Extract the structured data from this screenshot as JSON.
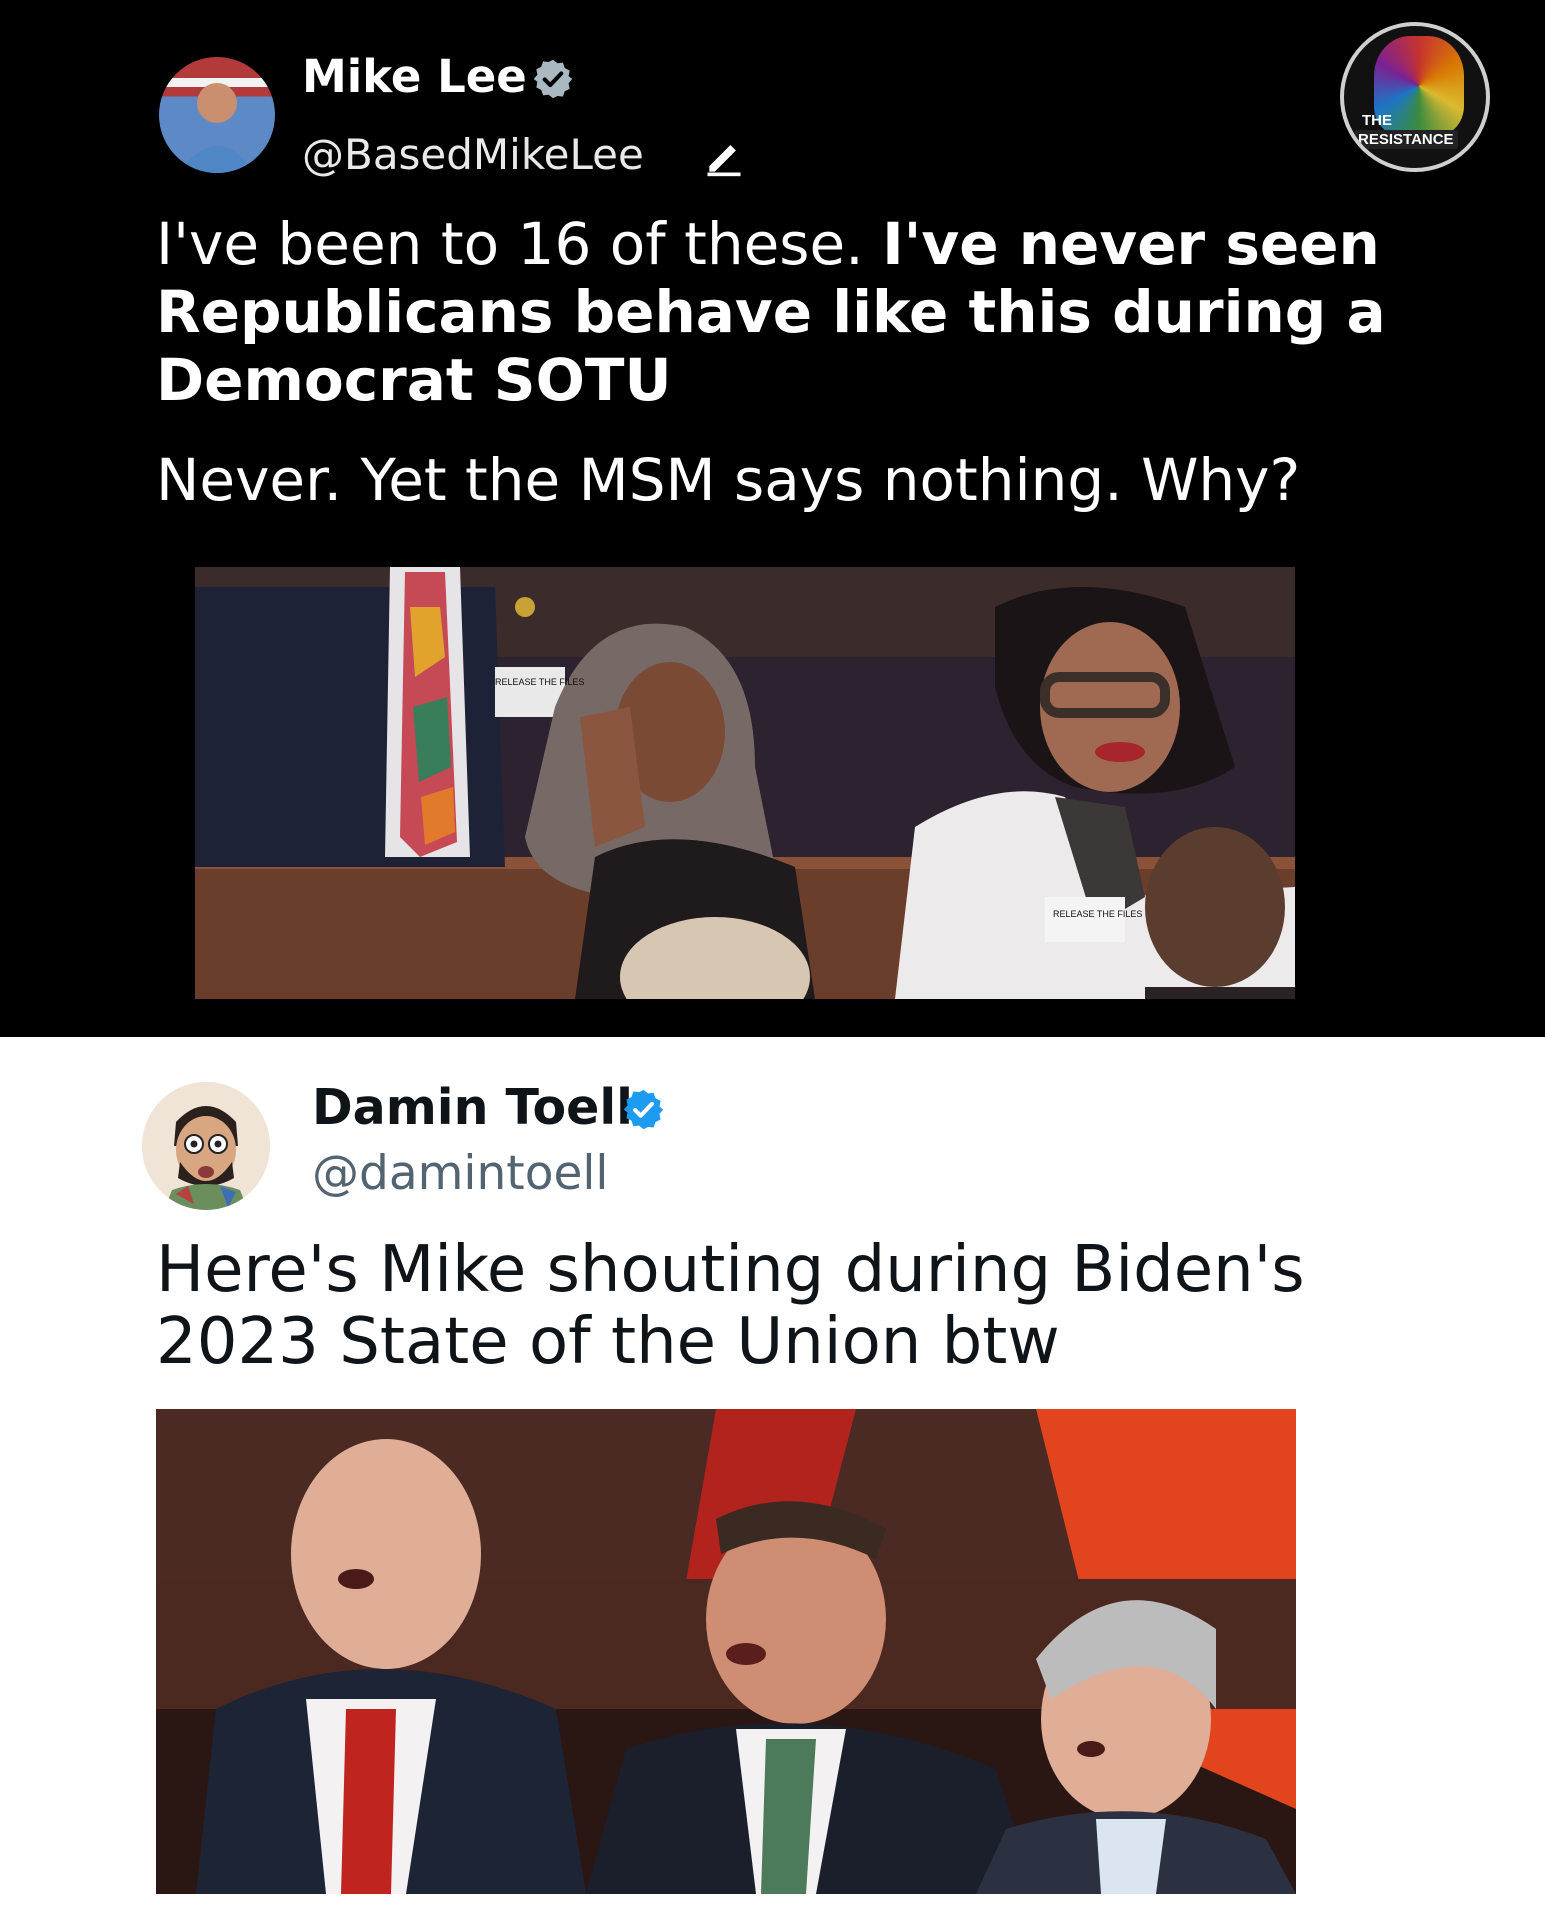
{
  "tweet1": {
    "name": "Mike Lee",
    "handle": "@BasedMikeLee",
    "text_line1_regular": "I've been to 16 of these. ",
    "text_line1_bold": "I've never seen",
    "text_line2": "Republicans behave like this during a",
    "text_line3": "Democrat SOTU",
    "text_line4": "Never. Yet the MSM says nothing. Why?",
    "photo_sign_left": "RELEASE THE FILES",
    "photo_sign_right": "RELEASE THE FILES"
  },
  "badge": {
    "line1": "THE",
    "line2": "RESISTANCE"
  },
  "tweet2": {
    "name": "Damin Toell",
    "handle": "@damintoell",
    "text_line1": "Here's Mike shouting during Biden's",
    "text_line2": "2023 State of the Union btw"
  },
  "colors": {
    "verified_gray": "#aab8c2",
    "verified_blue": "#1d9bf0",
    "dark_bg": "#000000",
    "light_bg": "#ffffff"
  }
}
